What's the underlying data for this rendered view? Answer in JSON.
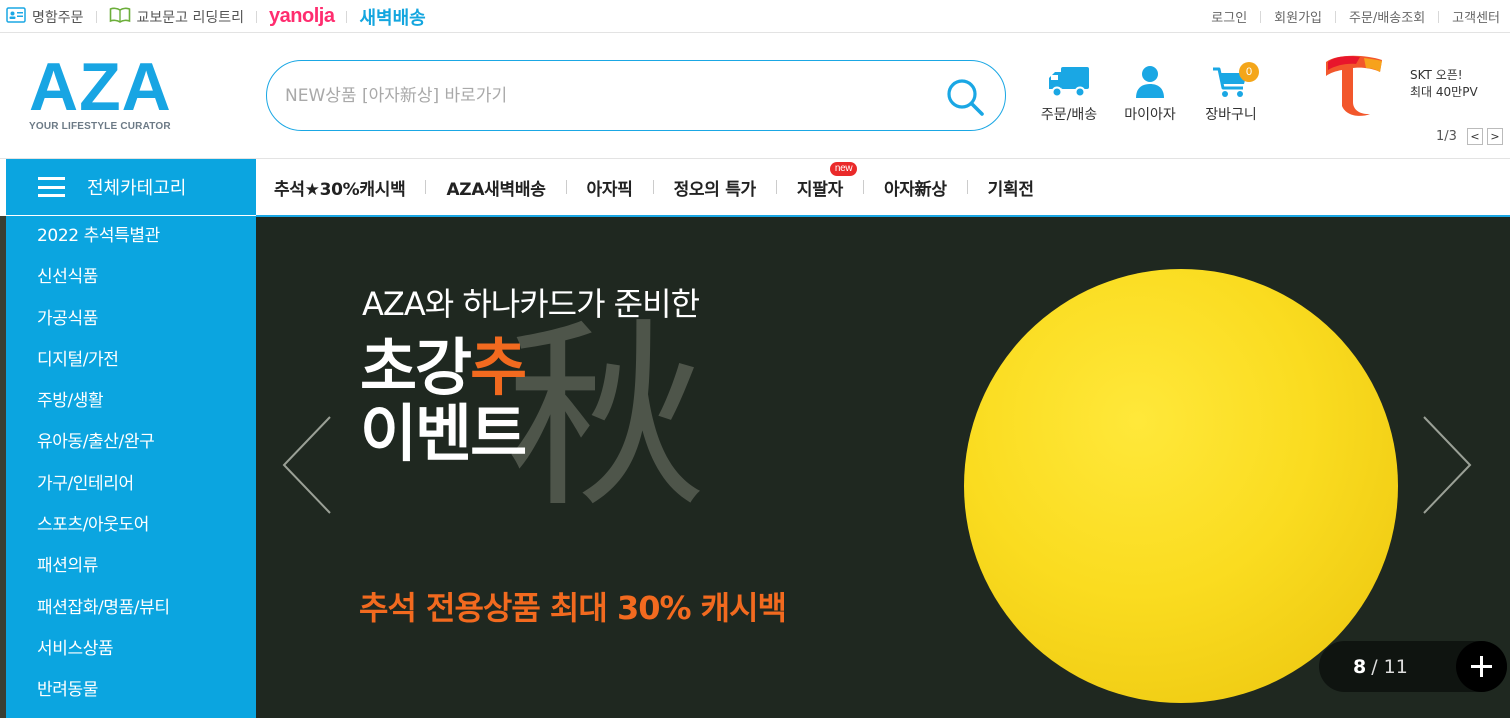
{
  "topbar": {
    "left": [
      {
        "label": "명함주문",
        "icon": "id-card-icon"
      },
      {
        "label": "교보문고 리딩트리",
        "icon": "open-book-icon"
      },
      {
        "label": "yanolja"
      },
      {
        "label": "새벽배송"
      }
    ],
    "right": [
      "로그인",
      "회원가입",
      "주문/배송조회",
      "고객센터"
    ]
  },
  "logo": {
    "word": "AZA",
    "tagline": "YOUR LIFESTYLE CURATOR"
  },
  "search": {
    "placeholder": "NEW상품 [아자新상] 바로가기",
    "value": ""
  },
  "header_icons": {
    "order": "주문/배송",
    "mypage": "마이아자",
    "cart": "장바구니",
    "cart_count": "0"
  },
  "promo": {
    "line1": "SKT 오픈!",
    "line2": "최대 40만PV",
    "page": "1/3",
    "prev": "<",
    "next": ">"
  },
  "category_header": "전체카테고리",
  "gnb": [
    {
      "label": "추석★30%캐시백"
    },
    {
      "label": "AZA새벽배송"
    },
    {
      "label": "아자픽"
    },
    {
      "label": "정오의 특가"
    },
    {
      "label": "지팔자",
      "badge": "new"
    },
    {
      "label": "아자新상"
    },
    {
      "label": "기획전"
    }
  ],
  "categories": [
    "2022 추석특별관",
    "신선식품",
    "가공식품",
    "디지털/가전",
    "주방/생활",
    "유아동/출산/완구",
    "가구/인테리어",
    "스포츠/아웃도어",
    "패션의류",
    "패션잡화/명품/뷰티",
    "서비스상품",
    "반려동물"
  ],
  "banner": {
    "subtitle": "AZA와 하나카드가 준비한",
    "title_a": "초강",
    "title_hl": "추",
    "title_b": "이벤트",
    "hanja": "秋",
    "offer": "추석 전용상품 최대 30% 캐시백",
    "current": "8",
    "total": "/ 11"
  },
  "colors": {
    "brand": "#18a5e3",
    "category_bg": "#0ba5e0",
    "accent_orange": "#f26a1f",
    "banner_bg": "#1f2820",
    "cart_badge": "#f4a61a",
    "yanolja": "#ff2d6f"
  }
}
